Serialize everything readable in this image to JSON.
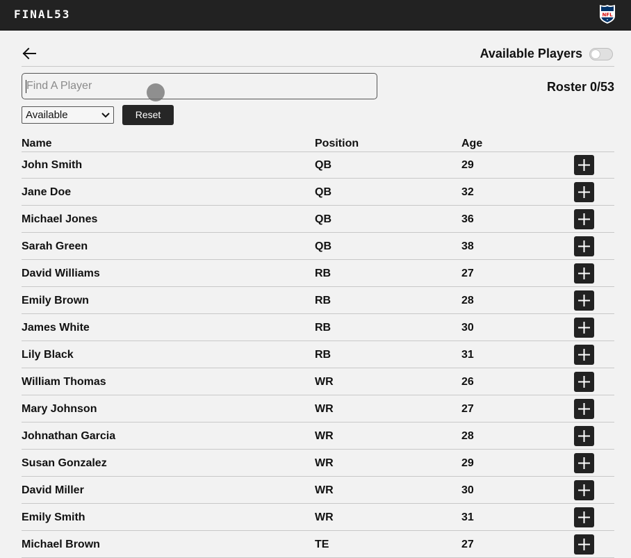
{
  "app": {
    "brand": "FINAL53"
  },
  "header": {
    "available_players_label": "Available Players",
    "roster_label": "Roster 0/53"
  },
  "search": {
    "placeholder": "Find A Player",
    "value": ""
  },
  "filter": {
    "selected": "Available",
    "reset_label": "Reset"
  },
  "table": {
    "columns": [
      "Name",
      "Position",
      "Age"
    ],
    "rows": [
      {
        "name": "John Smith",
        "position": "QB",
        "age": "29"
      },
      {
        "name": "Jane Doe",
        "position": "QB",
        "age": "32"
      },
      {
        "name": "Michael Jones",
        "position": "QB",
        "age": "36"
      },
      {
        "name": "Sarah Green",
        "position": "QB",
        "age": "38"
      },
      {
        "name": "David Williams",
        "position": "RB",
        "age": "27"
      },
      {
        "name": "Emily Brown",
        "position": "RB",
        "age": "28"
      },
      {
        "name": "James White",
        "position": "RB",
        "age": "30"
      },
      {
        "name": "Lily Black",
        "position": "RB",
        "age": "31"
      },
      {
        "name": "William Thomas",
        "position": "WR",
        "age": "26"
      },
      {
        "name": "Mary Johnson",
        "position": "WR",
        "age": "27"
      },
      {
        "name": "Johnathan Garcia",
        "position": "WR",
        "age": "28"
      },
      {
        "name": "Susan Gonzalez",
        "position": "WR",
        "age": "29"
      },
      {
        "name": "David Miller",
        "position": "WR",
        "age": "30"
      },
      {
        "name": "Emily Smith",
        "position": "WR",
        "age": "31"
      },
      {
        "name": "Michael Brown",
        "position": "TE",
        "age": "27"
      }
    ]
  },
  "icons": {
    "back": "arrow-left-icon",
    "add": "plus-icon",
    "logo": "nfl-shield-logo"
  },
  "colors": {
    "topbar": "#222222",
    "button": "#222222",
    "background": "#f2f2f2"
  }
}
